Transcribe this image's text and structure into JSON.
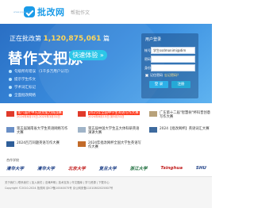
{
  "header": {
    "logo_text": "批改网",
    "logo_url": "www.pigai.org",
    "tagline": "帮批作文"
  },
  "banner": {
    "counter_prefix": "正在批改第",
    "counter_number": "1,120,875,061",
    "counter_suffix": "篇",
    "slogan": "替作文把脉",
    "cta_label": "快速体验 »",
    "features": [
      "句级所有错误 （1千多万用户认可）",
      "提示学生作文",
      "学术词汇标记",
      "全面批改网络"
    ]
  },
  "login": {
    "title": "用户登录",
    "username_label": "帐号",
    "username_value": "学生ssdmonimi@dim",
    "password_label": "密码",
    "password_value": "",
    "role_label": "身份",
    "role_value": "",
    "remember_label": "记住密码",
    "forgot_label": "忘记密码？",
    "login_button": "登 录",
    "register_button": "注册"
  },
  "news": [
    {
      "title": "第八届叶中先语文能力挑战赛",
      "date": "2024年8月15日-2025年3月31日",
      "hot": true
    },
    {
      "title": "2025年全国中学生英语写作大赛",
      "date": "2024年8月15日 到5月31日",
      "hot": true
    },
    {
      "title": "广东第十二届\"智慧树\"杯科普创意\n写作大赛",
      "date": "",
      "hot": false
    },
    {
      "title": "第五届湖南省大学生英语网络写作\n大赛",
      "date": "",
      "hot": false
    },
    {
      "title": "第五届中国大学生五大体科研英语\n演讲大赛",
      "date": "",
      "hot": false
    },
    {
      "title": "2024【批改网杯】英语词汇大赛",
      "date": "",
      "hot": false
    },
    {
      "title": "2024百万同题英语写作大赛",
      "date": "",
      "hot": false
    },
    {
      "title": "2024年批改网杯全国大学生英语写\n作大赛",
      "date": "",
      "hot": false
    }
  ],
  "partners": {
    "title": "合作学校",
    "logos": [
      "清华大学",
      "清华大学",
      "北京大学",
      "复旦大学",
      "浙江大学",
      "Tsinghua",
      "SHU"
    ]
  },
  "footer": {
    "line1": "关于我们 | 联系我们 | 加入我们 | 法律声明 | 技术支持 | 作文题库 | 学习资源 | 下载中心",
    "line2": "Copyright ©2010-2024 批改网 京ICP备10040075号 京公网安备11010802025807号"
  },
  "colors": {
    "brand": "#1a9be8",
    "banner_top": "#2a6fc4",
    "accent": "#ffd65a",
    "hot": "#ff3b1e"
  }
}
